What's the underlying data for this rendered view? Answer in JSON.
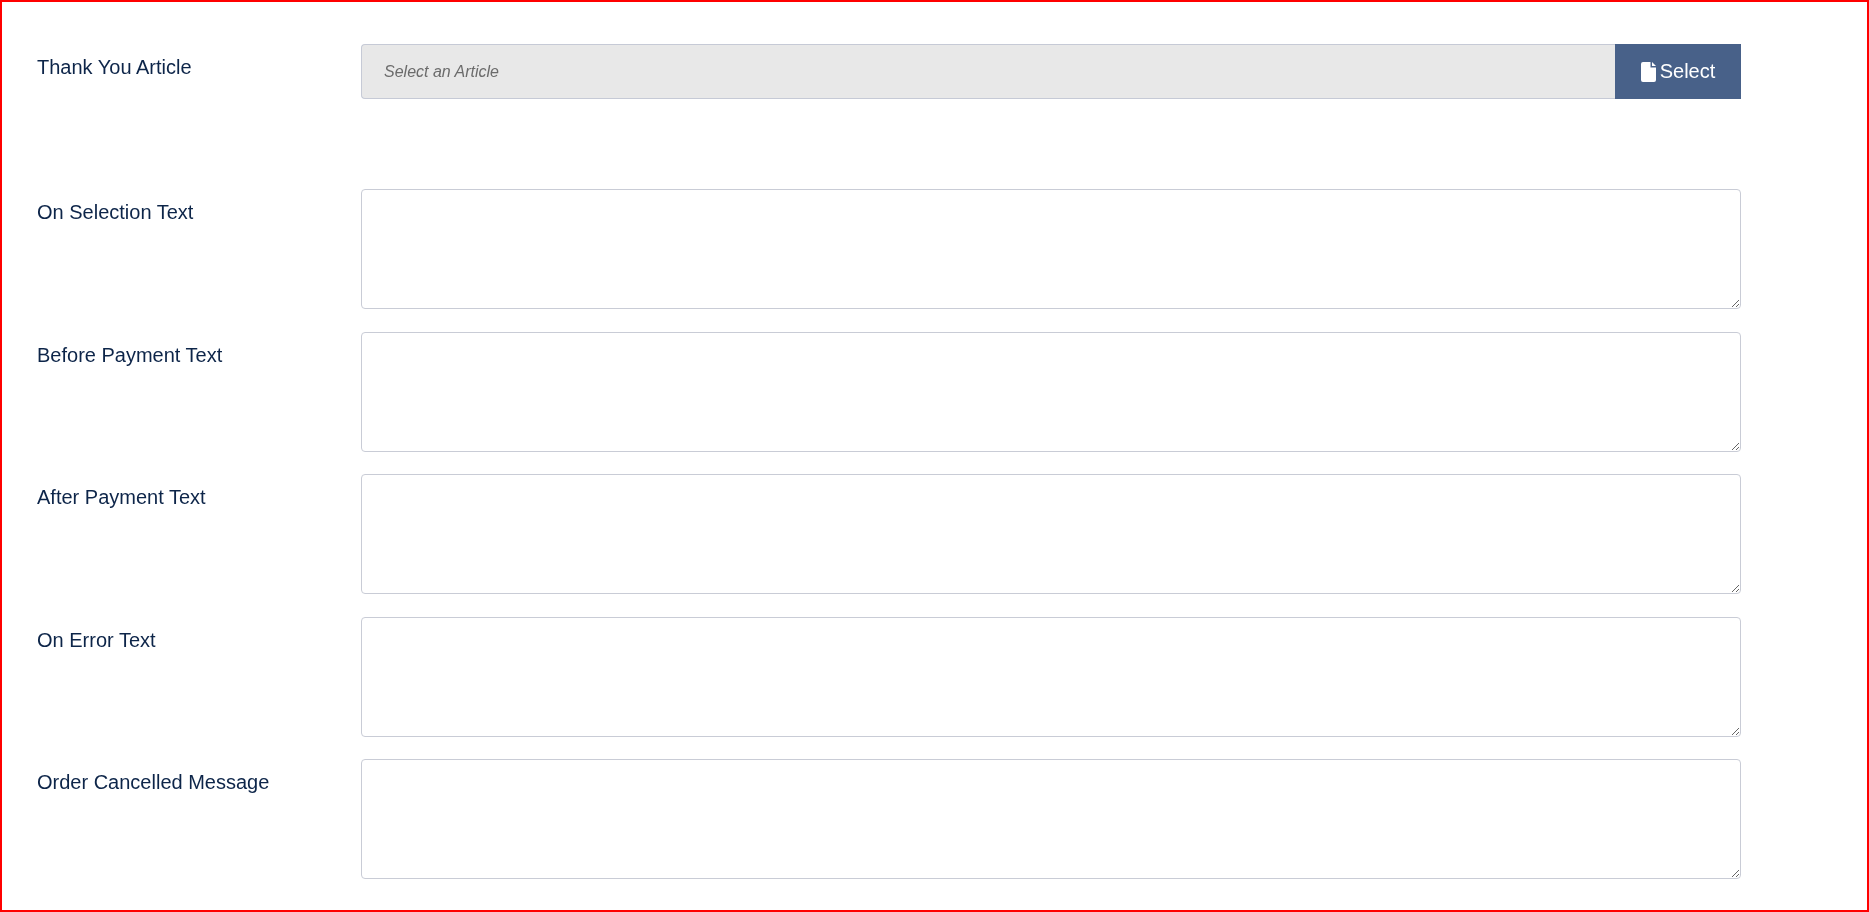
{
  "article": {
    "label": "Thank You Article",
    "placeholder": "Select an Article",
    "button": "Select"
  },
  "text_fields": [
    {
      "label": "On Selection Text"
    },
    {
      "label": "Before Payment Text"
    },
    {
      "label": "After Payment Text"
    },
    {
      "label": "On Error Text"
    },
    {
      "label": "Order Cancelled Message"
    }
  ]
}
